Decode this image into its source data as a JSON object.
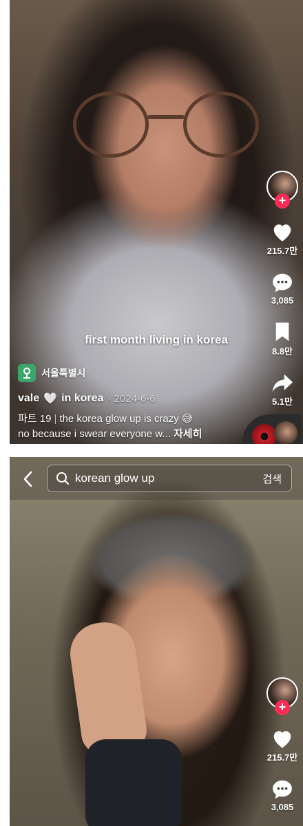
{
  "post1": {
    "overlay_text": "first month living in korea",
    "location": "서울특별시",
    "author": "vale",
    "author_suffix": "in korea",
    "date": "· 2024-6-6",
    "part": "파트 19",
    "separator": "|",
    "caption_line1": "the korea glow up is crazy 😅",
    "caption_line2": "no because i swear everyone w...",
    "see_more": "자세히",
    "likes": "215.7만",
    "comments": "3,085",
    "bookmarks": "8.8만",
    "shares": "5.1만"
  },
  "post2": {
    "likes": "215.7만",
    "comments": "3,085"
  },
  "search": {
    "query": "korean glow up",
    "submit_label": "검색"
  },
  "icons": {
    "follow": "plus-icon",
    "like": "heart-icon",
    "comment": "comment-icon",
    "bookmark": "bookmark-icon",
    "share": "share-icon",
    "location": "map-pin-icon",
    "back": "chevron-left-icon",
    "search": "search-icon"
  },
  "colors": {
    "follow_badge": "#fe2c55",
    "location_badge": "#3aa66b"
  }
}
